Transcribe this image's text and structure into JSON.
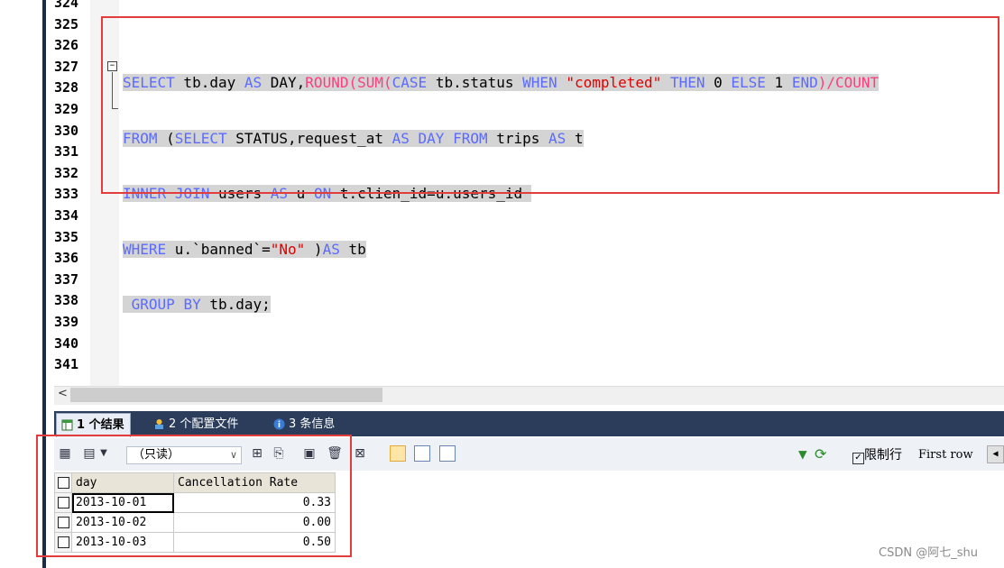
{
  "editor": {
    "line_numbers": [
      "324",
      "325",
      "326",
      "327",
      "328",
      "329",
      "330",
      "331",
      "332",
      "333",
      "334",
      "335",
      "336",
      "337",
      "338",
      "339",
      "340",
      "341"
    ],
    "code": {
      "line326": {
        "select": "SELECT",
        "tbday": " tb.day ",
        "as1": "AS",
        "dayalias": " DAY,",
        "round": "ROUND",
        "p1": "(",
        "sum": "SUM",
        "p2": "(",
        "case": "CASE",
        "tbstatus": " tb.status ",
        "when": "WHEN",
        "sp1": " ",
        "completed": "\"completed\"",
        "sp2": " ",
        "then": "THEN",
        "zero": " 0 ",
        "else": "ELSE",
        "one": " 1 ",
        "end": "END",
        "rest": ")/",
        "count": "COUNT"
      },
      "line327": {
        "from": "FROM",
        "sp": " (",
        "select": "SELECT",
        "status": " STATUS,request_at ",
        "as": "AS",
        "sp2": " ",
        "day": "DAY",
        "sp3": " ",
        "from2": "FROM",
        "trips": " trips ",
        "as2": "AS",
        "t": " t"
      },
      "line328": {
        "inner": "INNER",
        "sp": " ",
        "join": "JOIN",
        "users": " users ",
        "as": "AS",
        "u": " u ",
        "on": "ON",
        "cond": " t.clien_id=u.users_id "
      },
      "line329": {
        "where": "WHERE",
        "ub": " u.`banned`=",
        "no": "\"No\"",
        "sp": " )",
        "as": "AS",
        "tb": " tb"
      },
      "line330": {
        "sp": " ",
        "group": "GROUP",
        "sp2": " ",
        "by": "BY",
        "rest": " tb.day;"
      }
    }
  },
  "tabs": [
    {
      "label": "1 个结果"
    },
    {
      "label": "2 个配置文件"
    },
    {
      "label": "3 条信息"
    }
  ],
  "toolbar": {
    "readonly_label": "（只读）",
    "limit_label": "限制行",
    "first_row_label": "First row"
  },
  "results": {
    "columns": [
      "day",
      "Cancellation Rate"
    ],
    "rows": [
      {
        "day": "2013-10-01",
        "rate": "0.33"
      },
      {
        "day": "2013-10-02",
        "rate": "0.00"
      },
      {
        "day": "2013-10-03",
        "rate": "0.50"
      }
    ]
  },
  "watermark": "CSDN @阿七_shu",
  "colors": {
    "keyword": "#5b6bff",
    "function": "#ff3c7d",
    "string": "#e00000",
    "highlight_frame": "#e23c3c",
    "tabs_bar": "#2b3d5b"
  }
}
